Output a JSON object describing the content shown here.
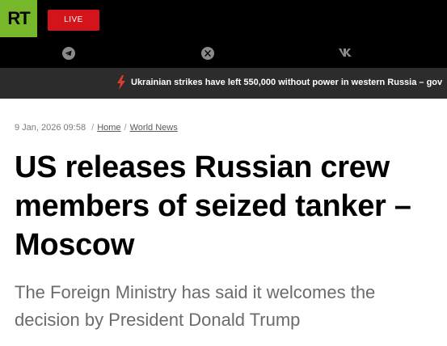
{
  "header": {
    "logo_text": "RT",
    "logo_color": "#77b82a",
    "live_label": "LIVE",
    "live_color": "#d3141b",
    "social_icons": [
      "telegram-icon",
      "x-icon",
      "vk-icon"
    ]
  },
  "ticker": {
    "icon": "lightning-icon",
    "icon_color": "#e03a2f",
    "text": "Ukrainian strikes have left 550,000 without power in western Russia – gov"
  },
  "article": {
    "date": "9 Jan, 2026 09:58",
    "breadcrumbs": [
      "Home",
      "World News"
    ],
    "breadcrumb_separator": "/",
    "title": "US releases Russian crew members of seized tanker – Moscow",
    "summary": "The Foreign Ministry has said it welcomes the decision by President Donald Trump"
  }
}
